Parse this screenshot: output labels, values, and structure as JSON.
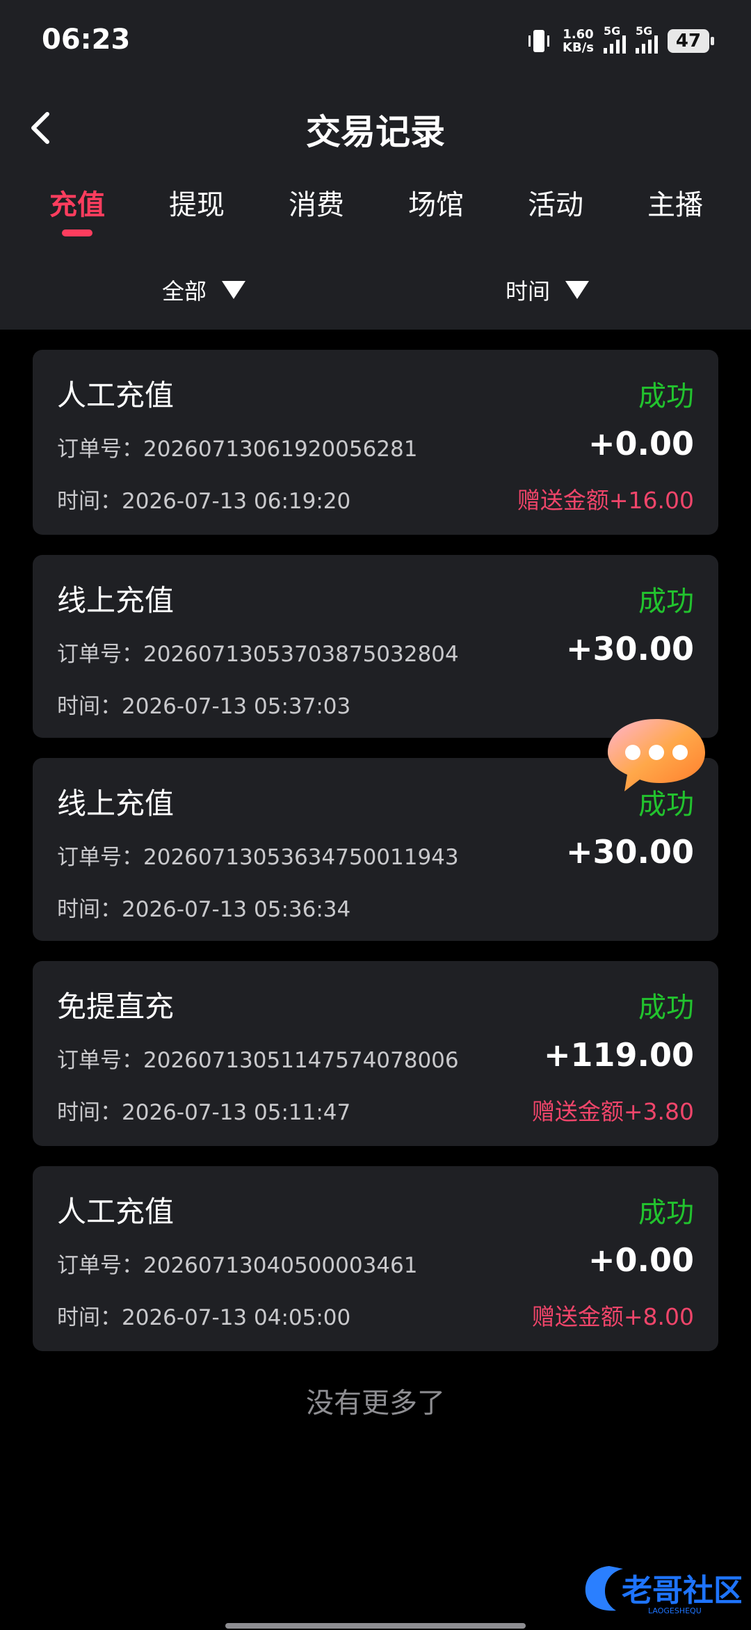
{
  "status_bar": {
    "time": "06:23",
    "net_speed_value": "1.60",
    "net_speed_unit": "KB/s",
    "sim1_label": "5G",
    "sim2_label": "5G",
    "battery": "47"
  },
  "header": {
    "title": "交易记录"
  },
  "tabs": [
    {
      "label": "充值",
      "active": true
    },
    {
      "label": "提现",
      "active": false
    },
    {
      "label": "消费",
      "active": false
    },
    {
      "label": "场馆",
      "active": false
    },
    {
      "label": "活动",
      "active": false
    },
    {
      "label": "主播",
      "active": false
    }
  ],
  "filters": {
    "type_label": "全部",
    "time_label": "时间"
  },
  "records": [
    {
      "title": "人工充值",
      "status": "成功",
      "order": "订单号：20260713061920056281",
      "amount": "+0.00",
      "time": "时间：2026-07-13 06:19:20",
      "bonus": "赠送金额+16.00"
    },
    {
      "title": "线上充值",
      "status": "成功",
      "order": "订单号：20260713053703875032804",
      "amount": "+30.00",
      "time": "时间：2026-07-13 05:37:03",
      "bonus": ""
    },
    {
      "title": "线上充值",
      "status": "成功",
      "order": "订单号：20260713053634750011943",
      "amount": "+30.00",
      "time": "时间：2026-07-13 05:36:34",
      "bonus": ""
    },
    {
      "title": "免提直充",
      "status": "成功",
      "order": "订单号：20260713051147574078006",
      "amount": "+119.00",
      "time": "时间：2026-07-13 05:11:47",
      "bonus": "赠送金额+3.80"
    },
    {
      "title": "人工充值",
      "status": "成功",
      "order": "订单号：20260713040500003461",
      "amount": "+0.00",
      "time": "时间：2026-07-13 04:05:00",
      "bonus": "赠送金额+8.00"
    }
  ],
  "footer": {
    "no_more": "没有更多了"
  },
  "watermark": {
    "text": "老哥社区",
    "subtext": "LAOGESHEQU"
  },
  "colors": {
    "accent": "#ff3d5e",
    "success": "#22c32e",
    "bonus": "#f0456a",
    "card_bg": "#1f2024",
    "page_bg": "#000000"
  },
  "icons": {
    "back": "chevron-left-icon",
    "dropdown": "triangle-down-icon",
    "chat": "chat-bubble-icon"
  }
}
